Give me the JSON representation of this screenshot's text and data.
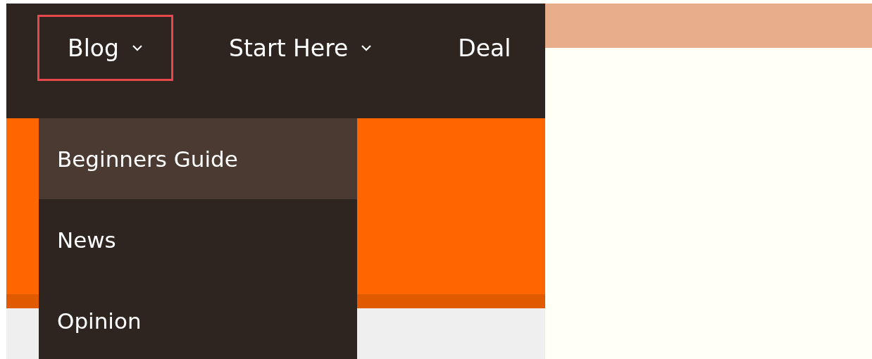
{
  "nav": {
    "items": [
      {
        "label": "Blog",
        "has_menu": true,
        "highlighted": true
      },
      {
        "label": "Start Here",
        "has_menu": true,
        "highlighted": false
      },
      {
        "label": "Deal",
        "has_menu": false,
        "highlighted": false
      }
    ]
  },
  "dropdown": {
    "items": [
      {
        "label": "Beginners Guide",
        "selected": true
      },
      {
        "label": "News",
        "selected": false
      },
      {
        "label": "Opinion",
        "selected": false
      }
    ]
  }
}
